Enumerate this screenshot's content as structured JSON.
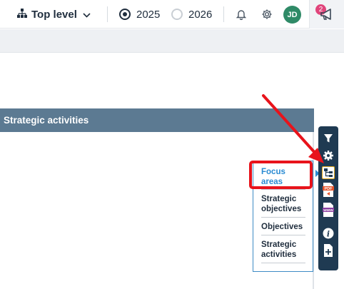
{
  "header": {
    "level_label": "Top level",
    "years": [
      {
        "label": "2025",
        "selected": true
      },
      {
        "label": "2026",
        "selected": false
      }
    ],
    "avatar_initials": "JD",
    "notification_count": "2"
  },
  "panel": {
    "title": "Strategic activities"
  },
  "view_menu": {
    "items": [
      {
        "label": "Focus areas",
        "active": true
      },
      {
        "label": "Strategic objectives",
        "active": false
      },
      {
        "label": "Objectives",
        "active": false
      },
      {
        "label": "Strategic activities",
        "active": false
      }
    ]
  },
  "toolbar": {
    "tools": [
      "filter-icon",
      "settings-icon",
      "hierarchy-icon",
      "pdf-export-icon",
      "web-export-icon",
      "info-icon",
      "add-page-icon"
    ]
  },
  "colors": {
    "panel_header": "#5c7a92",
    "toolbar_bg": "#1f3a52",
    "accent_blue": "#2a8bd2",
    "highlight_red": "#e8131b",
    "avatar_green": "#2f8a67",
    "badge_pink": "#e0447b"
  }
}
